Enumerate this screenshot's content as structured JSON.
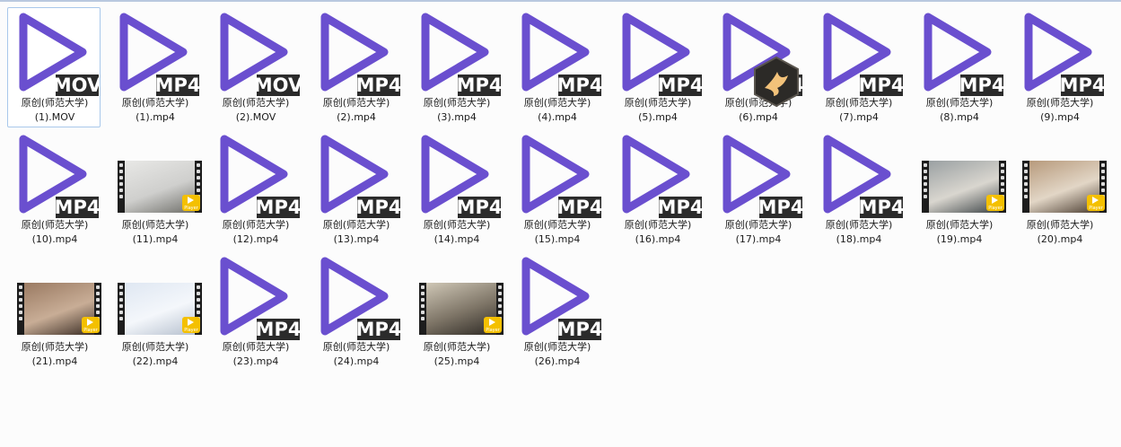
{
  "files": [
    {
      "name_line1": "原创(师范大学)",
      "name_line2": "(1).MOV",
      "badge": "MOV",
      "thumb": "video-icon",
      "selected": true
    },
    {
      "name_line1": "原创(师范大学)",
      "name_line2": "(1).mp4",
      "badge": "MP4",
      "thumb": "video-icon"
    },
    {
      "name_line1": "原创(师范大学)",
      "name_line2": "(2).MOV",
      "badge": "MOV",
      "thumb": "video-icon"
    },
    {
      "name_line1": "原创(师范大学)",
      "name_line2": "(2).mp4",
      "badge": "MP4",
      "thumb": "video-icon"
    },
    {
      "name_line1": "原创(师范大学)",
      "name_line2": "(3).mp4",
      "badge": "MP4",
      "thumb": "video-icon"
    },
    {
      "name_line1": "原创(师范大学)",
      "name_line2": "(4).mp4",
      "badge": "MP4",
      "thumb": "video-icon"
    },
    {
      "name_line1": "原创(师范大学)",
      "name_line2": "(5).mp4",
      "badge": "MP4",
      "thumb": "video-icon"
    },
    {
      "name_line1": "原创(师范大学)",
      "name_line2": "(6).mp4",
      "badge": "MP4",
      "thumb": "video-icon"
    },
    {
      "name_line1": "原创(师范大学)",
      "name_line2": "(7).mp4",
      "badge": "MP4",
      "thumb": "video-icon"
    },
    {
      "name_line1": "原创(师范大学)",
      "name_line2": "(8).mp4",
      "badge": "MP4",
      "thumb": "video-icon"
    },
    {
      "name_line1": "原创(师范大学)",
      "name_line2": "(9).mp4",
      "badge": "MP4",
      "thumb": "video-icon"
    },
    {
      "name_line1": "原创(师范大学)",
      "name_line2": "(10).mp4",
      "badge": "MP4",
      "thumb": "video-icon"
    },
    {
      "name_line1": "原创(师范大学)",
      "name_line2": "(11).mp4",
      "thumb": "photo",
      "palette": [
        "#e8e8e6",
        "#cfcfcd",
        "#6f6f6a"
      ]
    },
    {
      "name_line1": "原创(师范大学)",
      "name_line2": "(12).mp4",
      "badge": "MP4",
      "thumb": "video-icon"
    },
    {
      "name_line1": "原创(师范大学)",
      "name_line2": "(13).mp4",
      "badge": "MP4",
      "thumb": "video-icon"
    },
    {
      "name_line1": "原创(师范大学)",
      "name_line2": "(14).mp4",
      "badge": "MP4",
      "thumb": "video-icon"
    },
    {
      "name_line1": "原创(师范大学)",
      "name_line2": "(15).mp4",
      "badge": "MP4",
      "thumb": "video-icon"
    },
    {
      "name_line1": "原创(师范大学)",
      "name_line2": "(16).mp4",
      "badge": "MP4",
      "thumb": "video-icon"
    },
    {
      "name_line1": "原创(师范大学)",
      "name_line2": "(17).mp4",
      "badge": "MP4",
      "thumb": "video-icon"
    },
    {
      "name_line1": "原创(师范大学)",
      "name_line2": "(18).mp4",
      "badge": "MP4",
      "thumb": "video-icon"
    },
    {
      "name_line1": "原创(师范大学)",
      "name_line2": "(19).mp4",
      "thumb": "photo",
      "palette": [
        "#9aa0a2",
        "#d9d6cf",
        "#3e4548"
      ]
    },
    {
      "name_line1": "原创(师范大学)",
      "name_line2": "(20).mp4",
      "thumb": "photo",
      "palette": [
        "#b79a7c",
        "#e2d6c6",
        "#4a3c30"
      ]
    },
    {
      "name_line1": "原创(师范大学)",
      "name_line2": "(21).mp4",
      "thumb": "photo",
      "palette": [
        "#9a7a62",
        "#c8ad96",
        "#3a2d25"
      ]
    },
    {
      "name_line1": "原创(师范大学)",
      "name_line2": "(22).mp4",
      "thumb": "photo",
      "palette": [
        "#dfe7f2",
        "#f4f7fb",
        "#b7c1cf"
      ]
    },
    {
      "name_line1": "原创(师范大学)",
      "name_line2": "(23).mp4",
      "badge": "MP4",
      "thumb": "video-icon"
    },
    {
      "name_line1": "原创(师范大学)",
      "name_line2": "(24).mp4",
      "badge": "MP4",
      "thumb": "video-icon"
    },
    {
      "name_line1": "原创(师范大学)",
      "name_line2": "(25).mp4",
      "thumb": "photo",
      "palette": [
        "#cfc7b6",
        "#7d7466",
        "#2e2a25"
      ]
    },
    {
      "name_line1": "原创(师范大学)",
      "name_line2": "(26).mp4",
      "badge": "MP4",
      "thumb": "video-icon"
    }
  ],
  "player_badge_text": "Player",
  "overlay_icon": "bird-app-icon",
  "colors": {
    "play_stroke": "#6a4fcf",
    "badge_bg": "#2b2b2b",
    "badge_text": "#ffffff",
    "overlay_bg": "#2c2a27",
    "overlay_bird": "#f2c27a"
  }
}
